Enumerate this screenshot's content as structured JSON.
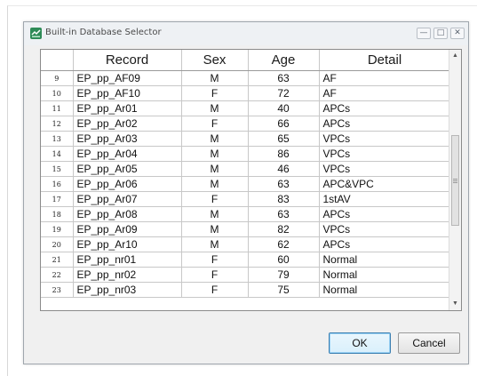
{
  "window": {
    "title": "Built-in Database Selector",
    "min_glyph": "—",
    "max_glyph": "□",
    "close_glyph": "✕",
    "accent": "#2e8b57"
  },
  "table": {
    "headers": [
      "",
      "Record",
      "Sex",
      "Age",
      "Detail"
    ],
    "rows": [
      {
        "num": "9",
        "record": "EP_pp_AF09",
        "sex": "M",
        "age": "63",
        "detail": "AF"
      },
      {
        "num": "10",
        "record": "EP_pp_AF10",
        "sex": "F",
        "age": "72",
        "detail": "AF"
      },
      {
        "num": "11",
        "record": "EP_pp_Ar01",
        "sex": "M",
        "age": "40",
        "detail": "APCs"
      },
      {
        "num": "12",
        "record": "EP_pp_Ar02",
        "sex": "F",
        "age": "66",
        "detail": "APCs"
      },
      {
        "num": "13",
        "record": "EP_pp_Ar03",
        "sex": "M",
        "age": "65",
        "detail": "VPCs"
      },
      {
        "num": "14",
        "record": "EP_pp_Ar04",
        "sex": "M",
        "age": "86",
        "detail": "VPCs"
      },
      {
        "num": "15",
        "record": "EP_pp_Ar05",
        "sex": "M",
        "age": "46",
        "detail": "VPCs"
      },
      {
        "num": "16",
        "record": "EP_pp_Ar06",
        "sex": "M",
        "age": "63",
        "detail": "APC&VPC"
      },
      {
        "num": "17",
        "record": "EP_pp_Ar07",
        "sex": "F",
        "age": "83",
        "detail": "1stAV"
      },
      {
        "num": "18",
        "record": "EP_pp_Ar08",
        "sex": "M",
        "age": "63",
        "detail": "APCs"
      },
      {
        "num": "19",
        "record": "EP_pp_Ar09",
        "sex": "M",
        "age": "82",
        "detail": "VPCs"
      },
      {
        "num": "20",
        "record": "EP_pp_Ar10",
        "sex": "M",
        "age": "62",
        "detail": "APCs"
      },
      {
        "num": "21",
        "record": "EP_pp_nr01",
        "sex": "F",
        "age": "60",
        "detail": "Normal"
      },
      {
        "num": "22",
        "record": "EP_pp_nr02",
        "sex": "F",
        "age": "79",
        "detail": "Normal"
      },
      {
        "num": "23",
        "record": "EP_pp_nr03",
        "sex": "F",
        "age": "75",
        "detail": "Normal"
      }
    ]
  },
  "scrollbar": {
    "up_glyph": "▲",
    "down_glyph": "▼"
  },
  "buttons": {
    "ok_label": "OK",
    "cancel_label": "Cancel"
  }
}
